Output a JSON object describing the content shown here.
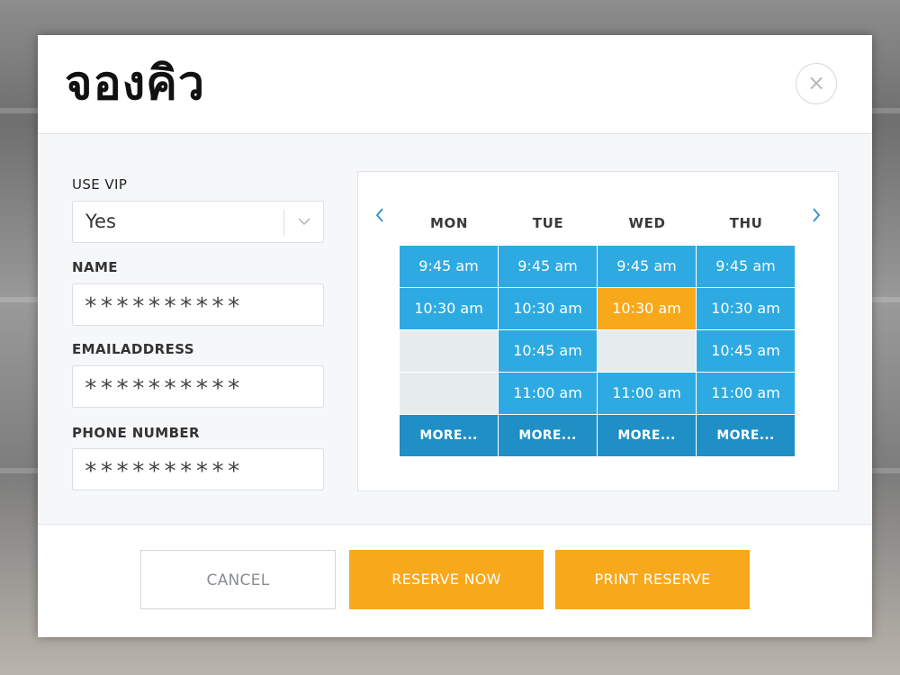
{
  "modal": {
    "title": "จองคิว",
    "close_symbol": "×"
  },
  "form": {
    "vip": {
      "label": "USE VIP",
      "value": "Yes"
    },
    "name": {
      "label": "NAME",
      "value": "**********"
    },
    "email": {
      "label": "EMAILADDRESS",
      "value": "**********"
    },
    "phone": {
      "label": "PHONE NUMBER",
      "value": "**********"
    }
  },
  "schedule": {
    "days": [
      "MON",
      "TUE",
      "WED",
      "THU"
    ],
    "rows": [
      [
        "9:45 am",
        "9:45 am",
        "9:45 am",
        "9:45 am"
      ],
      [
        "10:30 am",
        "10:30 am",
        "10:30 am",
        "10:30 am"
      ],
      [
        "",
        "10:45 am",
        "",
        "10:45 am"
      ],
      [
        "",
        "11:00 am",
        "11:00 am",
        "11:00 am"
      ]
    ],
    "selected_slot": "WED 10:30 am",
    "more_label": "MORE..."
  },
  "buttons": {
    "cancel": "CANCEL",
    "reserve": "RESERVE NOW",
    "print": "PRINT RESERVE"
  },
  "colors": {
    "accent": "#f7a81b",
    "slot": "#2daae2",
    "more": "#1f8fc5",
    "empty": "#e6ebee"
  },
  "icons": {
    "close": "close-icon",
    "select": "chevron-down-icon",
    "prev": "chevron-left-icon",
    "next": "chevron-right-icon"
  }
}
